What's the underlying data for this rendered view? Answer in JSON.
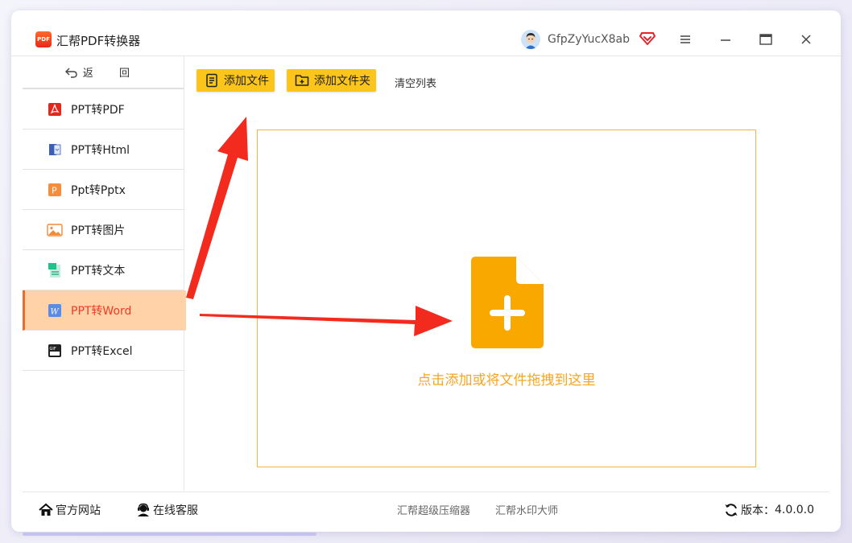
{
  "app": {
    "logo_text": "PDF",
    "title": "汇帮PDF转换器",
    "username": "GfpZyYucX8ab"
  },
  "sidebar": {
    "back_label": "返 回",
    "items": [
      {
        "label": "PPT转PDF",
        "icon": "pdf-icon"
      },
      {
        "label": "PPT转Html",
        "icon": "html-icon"
      },
      {
        "label": "Ppt转Pptx",
        "icon": "pptx-icon"
      },
      {
        "label": "PPT转图片",
        "icon": "image-icon"
      },
      {
        "label": "PPT转文本",
        "icon": "text-icon"
      },
      {
        "label": "PPT转Word",
        "icon": "word-icon",
        "active": true
      },
      {
        "label": "PPT转Excel",
        "icon": "excel-icon"
      }
    ]
  },
  "toolbar": {
    "add_file": "添加文件",
    "add_folder": "添加文件夹",
    "clear_list": "清空列表"
  },
  "dropzone": {
    "text": "点击添加或将文件拖拽到这里"
  },
  "footer": {
    "website": "官方网站",
    "support": "在线客服",
    "link1": "汇帮超级压缩器",
    "link2": "汇帮水印大师",
    "version_label": "版本：",
    "version": "4.0.0.0"
  },
  "colors": {
    "accent": "#fcc51b",
    "active_bg": "#ffd2a8",
    "active_text": "#ee3a25",
    "dropzone": "#f5a623",
    "arrow": "#f22b1e"
  }
}
